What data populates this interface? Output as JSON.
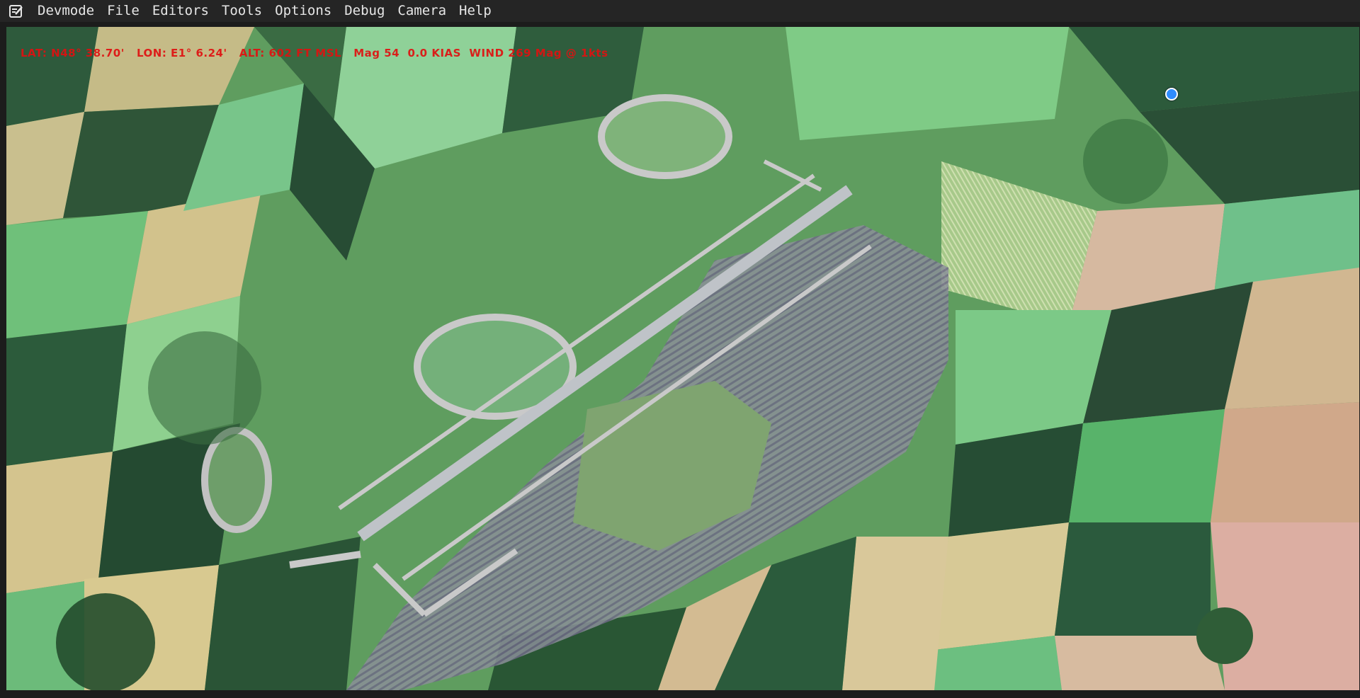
{
  "menubar": {
    "app_icon": "edit-note-icon",
    "items": [
      {
        "label": "Devmode"
      },
      {
        "label": "File"
      },
      {
        "label": "Editors"
      },
      {
        "label": "Tools"
      },
      {
        "label": "Options"
      },
      {
        "label": "Debug"
      },
      {
        "label": "Camera"
      },
      {
        "label": "Help"
      }
    ]
  },
  "hud": {
    "text": "LAT: N48° 38.70'   LON: E1° 6.24'   ALT: 602 FT MSL   Mag 54  0.0 KIAS  WIND 269 Mag @ 1kts",
    "color": "#e01010"
  },
  "map": {
    "marker_icon": "location-dot-icon",
    "marker_color": "#2f8cff"
  },
  "colors": {
    "menubar_bg": "#252525",
    "menu_text": "#e6e6e6",
    "field_light": "#7cc97f",
    "field_dark": "#2f5a3a",
    "field_tan": "#c9c08a",
    "runway": "#b8bcc0"
  }
}
